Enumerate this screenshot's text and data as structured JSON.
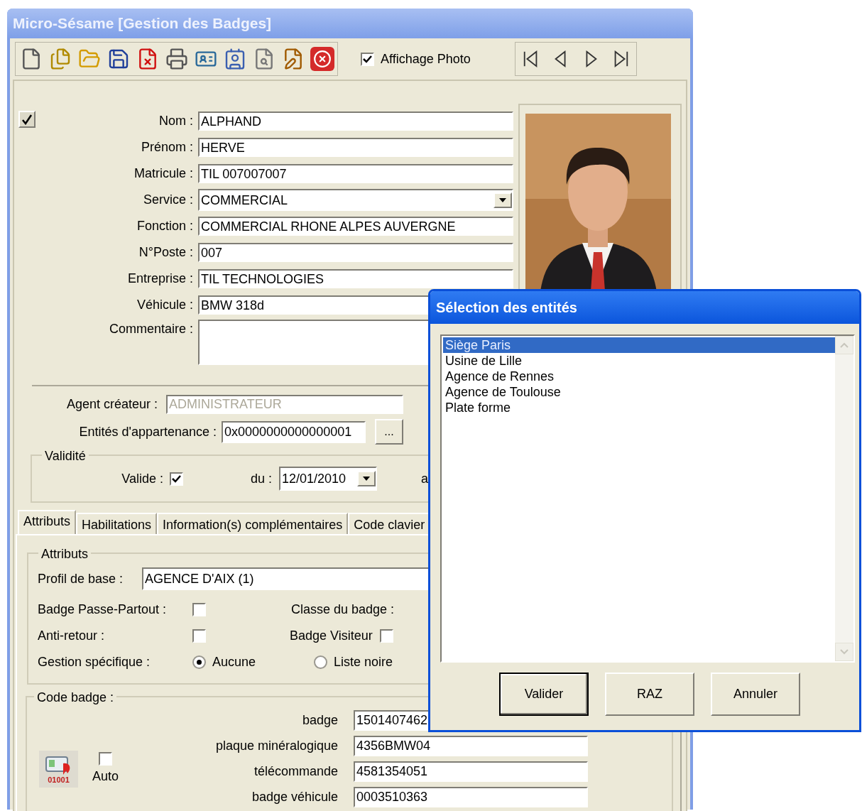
{
  "window": {
    "title": "Micro-Sésame [Gestion des Badges]"
  },
  "toolbar": {
    "photo_toggle": {
      "label": "Affichage Photo",
      "checked": true
    }
  },
  "record": {
    "checked": true
  },
  "fields": [
    {
      "kind": "text",
      "label": "Nom :",
      "value": "ALPHAND"
    },
    {
      "kind": "text",
      "label": "Prénom :",
      "value": "HERVE"
    },
    {
      "kind": "text",
      "label": "Matricule :",
      "value": "TIL 007007007"
    },
    {
      "kind": "dropdown",
      "label": "Service :",
      "value": "COMMERCIAL"
    },
    {
      "kind": "text",
      "label": "Fonction :",
      "value": "COMMERCIAL RHONE ALPES AUVERGNE"
    },
    {
      "kind": "text",
      "label": "N°Poste :",
      "value": "007"
    },
    {
      "kind": "text",
      "label": "Entreprise :",
      "value": "TIL TECHNOLOGIES"
    },
    {
      "kind": "text",
      "label": "Véhicule :",
      "value": "BMW 318d"
    },
    {
      "kind": "memo",
      "label": "Commentaire :"
    }
  ],
  "agent_createur": {
    "label": "Agent créateur :",
    "value": "ADMINISTRATEUR",
    "disabled": true
  },
  "entites": {
    "label": "Entités d'appartenance :",
    "value": "0x0000000000000001",
    "button": "..."
  },
  "validite": {
    "title": "Validité",
    "valide_label": "Valide :",
    "valide_checked": true,
    "du_label": "du :",
    "du_value": "12/01/2010",
    "au_label": "a"
  },
  "tabs": [
    {
      "label": "Attributs",
      "selected": true
    },
    {
      "label": "Habilitations",
      "selected": false
    },
    {
      "label": "Information(s) complémentaires",
      "selected": false
    },
    {
      "label": "Code clavier",
      "selected": false
    }
  ],
  "attributs": {
    "title": "Attributs",
    "profil_label": "Profil de base :",
    "profil_value": "AGENCE D'AIX (1)",
    "passe_partout": {
      "label": "Badge Passe-Partout :",
      "checked": false
    },
    "anti_retour": {
      "label": "Anti-retour :",
      "checked": false
    },
    "classe_label": "Classe du badge :",
    "visiteur": {
      "label": "Badge Visiteur",
      "checked": false
    },
    "gestion_label": "Gestion spécifique :",
    "gestion_options": [
      {
        "label": "Aucune",
        "selected": true
      },
      {
        "label": "Liste noire",
        "selected": false
      }
    ]
  },
  "code_badge": {
    "title": "Code badge :",
    "icon_caption": "01001",
    "auto": {
      "label": "Auto",
      "checked": false
    },
    "codes": [
      {
        "label": "badge",
        "value": "1501407462"
      },
      {
        "label": "plaque minéralogique",
        "value": "4356BMW04"
      },
      {
        "label": "télécommande",
        "value": "4581354051"
      },
      {
        "label": "badge véhicule",
        "value": "0003510363"
      }
    ]
  },
  "dialog": {
    "title": "Sélection des entités",
    "items": [
      {
        "label": "Siège Paris",
        "selected": true
      },
      {
        "label": "Usine de Lille",
        "selected": false
      },
      {
        "label": "Agence de Rennes",
        "selected": false
      },
      {
        "label": "Agence de Toulouse",
        "selected": false
      },
      {
        "label": "Plate forme",
        "selected": false
      }
    ],
    "buttons": [
      {
        "label": "Valider",
        "default": true
      },
      {
        "label": "RAZ",
        "default": false
      },
      {
        "label": "Annuler",
        "default": false
      }
    ]
  }
}
